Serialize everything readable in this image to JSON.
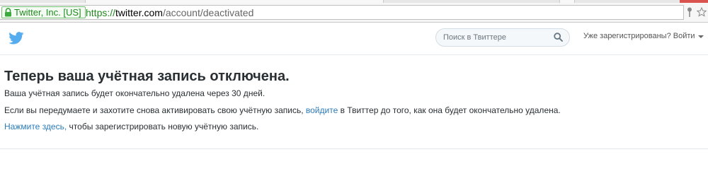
{
  "browser": {
    "ev_label": "Twitter, Inc. [US]",
    "url_scheme": "https://",
    "url_host": "twitter.com",
    "url_path": "/account/deactivated"
  },
  "header": {
    "search_placeholder": "Поиск в Твиттере",
    "login_text": "Уже зарегистрированы? Войти"
  },
  "main": {
    "title": "Теперь ваша учётная запись отключена.",
    "line1": "Ваша учётная запись будет окончательно удалена через 30 дней.",
    "line2_before": "Если вы передумаете и захотите снова активировать свою учётную запись, ",
    "line2_link": "войдите",
    "line2_after": " в Твиттер до того, как она будет окончательно удалена.",
    "line3_link": "Нажмите здесь,",
    "line3_after": " чтобы зарегистрировать новую учётную запись."
  },
  "colors": {
    "twitter_blue": "#55acee",
    "link": "#2b7bb9",
    "text": "#292f33",
    "ev_green": "#1f8a1f"
  },
  "icons": [
    "lock-icon",
    "twitter-bird-icon",
    "search-icon",
    "caret-down-icon",
    "pin-icon",
    "star-icon"
  ]
}
